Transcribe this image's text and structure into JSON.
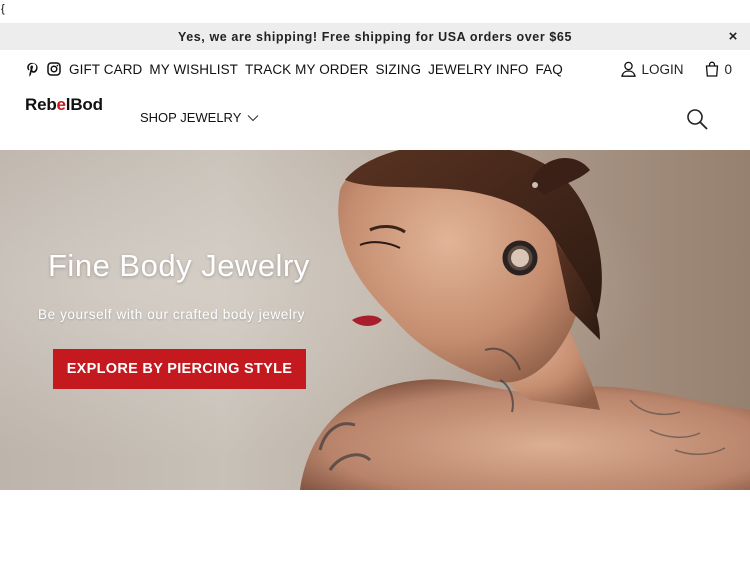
{
  "stray_char": "{",
  "announcement": {
    "text": "Yes, we are shipping!  Free shipping for USA orders over $65",
    "close": "×"
  },
  "top_nav": {
    "social": [
      "pinterest-icon",
      "instagram-icon"
    ],
    "links": [
      "GIFT CARD",
      "MY WISHLIST",
      "TRACK MY ORDER",
      "SIZING",
      "JEWELRY INFO",
      "FAQ"
    ],
    "login": "LOGIN",
    "cart_count": "0"
  },
  "logo": {
    "part1": "Reb",
    "mark": "e",
    "part2": "lBod"
  },
  "main_nav": {
    "shop": "SHOP JEWELRY"
  },
  "hero": {
    "title": "Fine Body Jewelry",
    "subtitle": "Be yourself with our crafted body jewelry",
    "cta": "EXPLORE BY PIERCING STYLE"
  },
  "colors": {
    "accent": "#c41a1f",
    "announce_bg": "#ededed"
  }
}
